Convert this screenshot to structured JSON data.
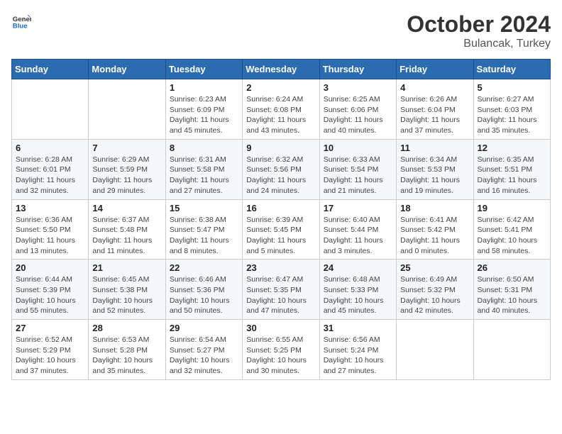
{
  "logo": {
    "general": "General",
    "blue": "Blue"
  },
  "title": {
    "month": "October 2024",
    "location": "Bulancak, Turkey"
  },
  "weekdays": [
    "Sunday",
    "Monday",
    "Tuesday",
    "Wednesday",
    "Thursday",
    "Friday",
    "Saturday"
  ],
  "weeks": [
    [
      {
        "day": "",
        "info": ""
      },
      {
        "day": "",
        "info": ""
      },
      {
        "day": "1",
        "info": "Sunrise: 6:23 AM\nSunset: 6:09 PM\nDaylight: 11 hours and 45 minutes."
      },
      {
        "day": "2",
        "info": "Sunrise: 6:24 AM\nSunset: 6:08 PM\nDaylight: 11 hours and 43 minutes."
      },
      {
        "day": "3",
        "info": "Sunrise: 6:25 AM\nSunset: 6:06 PM\nDaylight: 11 hours and 40 minutes."
      },
      {
        "day": "4",
        "info": "Sunrise: 6:26 AM\nSunset: 6:04 PM\nDaylight: 11 hours and 37 minutes."
      },
      {
        "day": "5",
        "info": "Sunrise: 6:27 AM\nSunset: 6:03 PM\nDaylight: 11 hours and 35 minutes."
      }
    ],
    [
      {
        "day": "6",
        "info": "Sunrise: 6:28 AM\nSunset: 6:01 PM\nDaylight: 11 hours and 32 minutes."
      },
      {
        "day": "7",
        "info": "Sunrise: 6:29 AM\nSunset: 5:59 PM\nDaylight: 11 hours and 29 minutes."
      },
      {
        "day": "8",
        "info": "Sunrise: 6:31 AM\nSunset: 5:58 PM\nDaylight: 11 hours and 27 minutes."
      },
      {
        "day": "9",
        "info": "Sunrise: 6:32 AM\nSunset: 5:56 PM\nDaylight: 11 hours and 24 minutes."
      },
      {
        "day": "10",
        "info": "Sunrise: 6:33 AM\nSunset: 5:54 PM\nDaylight: 11 hours and 21 minutes."
      },
      {
        "day": "11",
        "info": "Sunrise: 6:34 AM\nSunset: 5:53 PM\nDaylight: 11 hours and 19 minutes."
      },
      {
        "day": "12",
        "info": "Sunrise: 6:35 AM\nSunset: 5:51 PM\nDaylight: 11 hours and 16 minutes."
      }
    ],
    [
      {
        "day": "13",
        "info": "Sunrise: 6:36 AM\nSunset: 5:50 PM\nDaylight: 11 hours and 13 minutes."
      },
      {
        "day": "14",
        "info": "Sunrise: 6:37 AM\nSunset: 5:48 PM\nDaylight: 11 hours and 11 minutes."
      },
      {
        "day": "15",
        "info": "Sunrise: 6:38 AM\nSunset: 5:47 PM\nDaylight: 11 hours and 8 minutes."
      },
      {
        "day": "16",
        "info": "Sunrise: 6:39 AM\nSunset: 5:45 PM\nDaylight: 11 hours and 5 minutes."
      },
      {
        "day": "17",
        "info": "Sunrise: 6:40 AM\nSunset: 5:44 PM\nDaylight: 11 hours and 3 minutes."
      },
      {
        "day": "18",
        "info": "Sunrise: 6:41 AM\nSunset: 5:42 PM\nDaylight: 11 hours and 0 minutes."
      },
      {
        "day": "19",
        "info": "Sunrise: 6:42 AM\nSunset: 5:41 PM\nDaylight: 10 hours and 58 minutes."
      }
    ],
    [
      {
        "day": "20",
        "info": "Sunrise: 6:44 AM\nSunset: 5:39 PM\nDaylight: 10 hours and 55 minutes."
      },
      {
        "day": "21",
        "info": "Sunrise: 6:45 AM\nSunset: 5:38 PM\nDaylight: 10 hours and 52 minutes."
      },
      {
        "day": "22",
        "info": "Sunrise: 6:46 AM\nSunset: 5:36 PM\nDaylight: 10 hours and 50 minutes."
      },
      {
        "day": "23",
        "info": "Sunrise: 6:47 AM\nSunset: 5:35 PM\nDaylight: 10 hours and 47 minutes."
      },
      {
        "day": "24",
        "info": "Sunrise: 6:48 AM\nSunset: 5:33 PM\nDaylight: 10 hours and 45 minutes."
      },
      {
        "day": "25",
        "info": "Sunrise: 6:49 AM\nSunset: 5:32 PM\nDaylight: 10 hours and 42 minutes."
      },
      {
        "day": "26",
        "info": "Sunrise: 6:50 AM\nSunset: 5:31 PM\nDaylight: 10 hours and 40 minutes."
      }
    ],
    [
      {
        "day": "27",
        "info": "Sunrise: 6:52 AM\nSunset: 5:29 PM\nDaylight: 10 hours and 37 minutes."
      },
      {
        "day": "28",
        "info": "Sunrise: 6:53 AM\nSunset: 5:28 PM\nDaylight: 10 hours and 35 minutes."
      },
      {
        "day": "29",
        "info": "Sunrise: 6:54 AM\nSunset: 5:27 PM\nDaylight: 10 hours and 32 minutes."
      },
      {
        "day": "30",
        "info": "Sunrise: 6:55 AM\nSunset: 5:25 PM\nDaylight: 10 hours and 30 minutes."
      },
      {
        "day": "31",
        "info": "Sunrise: 6:56 AM\nSunset: 5:24 PM\nDaylight: 10 hours and 27 minutes."
      },
      {
        "day": "",
        "info": ""
      },
      {
        "day": "",
        "info": ""
      }
    ]
  ]
}
